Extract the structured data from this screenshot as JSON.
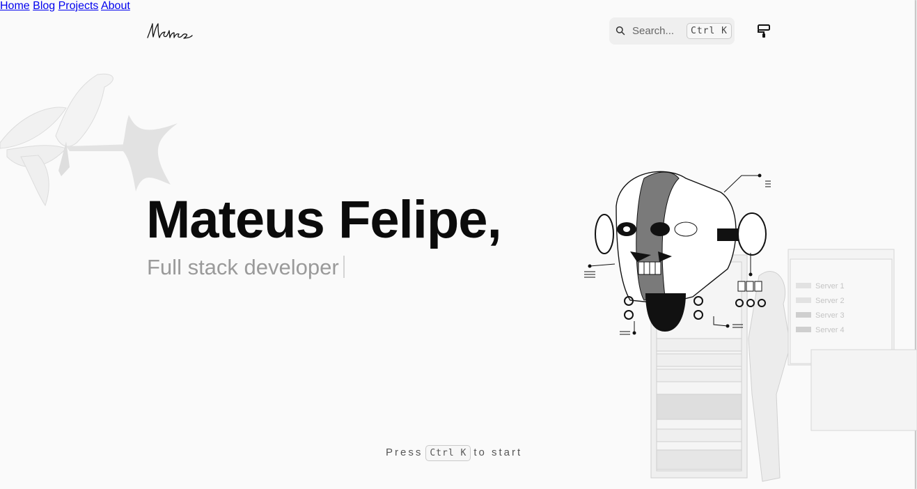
{
  "header": {
    "logo_alt": "Mateus signature",
    "nav": [
      {
        "label": "Home"
      },
      {
        "label": "Blog"
      },
      {
        "label": "Projects"
      },
      {
        "label": "About"
      }
    ],
    "search": {
      "placeholder": "Search...",
      "shortcut": "Ctrl K"
    },
    "theme_icon": "paint-roller-icon"
  },
  "hero": {
    "title": "Mateus Felipe,",
    "subtitle": "Full stack developer"
  },
  "illustration": {
    "servers": [
      "Server 1",
      "Server 2",
      "Server 3",
      "Server 4"
    ]
  },
  "cta": {
    "prefix": "Press",
    "shortcut": "Ctrl K",
    "suffix": "to start"
  }
}
